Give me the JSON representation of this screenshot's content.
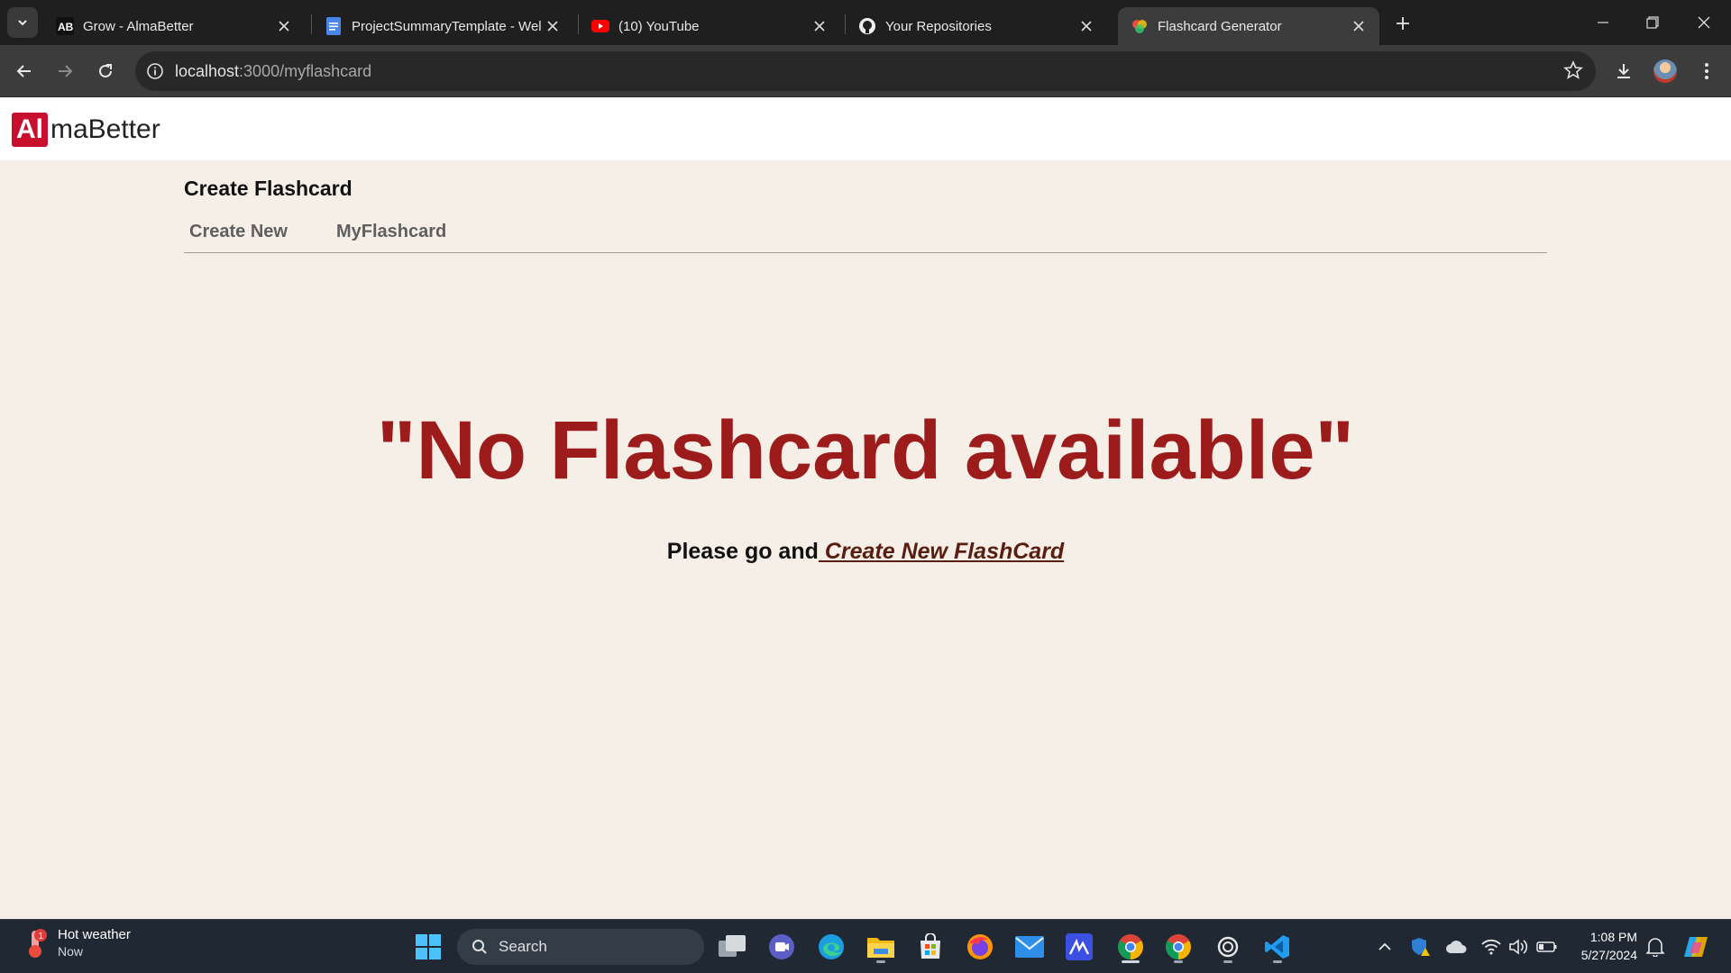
{
  "browser": {
    "tabs": [
      {
        "title": "Grow - AlmaBetter",
        "icon": "almabetter-favicon"
      },
      {
        "title": "ProjectSummaryTemplate - Wel",
        "icon": "google-docs-favicon"
      },
      {
        "title": "(10) YouTube",
        "icon": "youtube-favicon"
      },
      {
        "title": "Your Repositories",
        "icon": "github-favicon"
      },
      {
        "title": "Flashcard Generator",
        "icon": "react-favicon",
        "active": true
      }
    ],
    "url_host": "localhost",
    "url_path": ":3000/myflashcard"
  },
  "app": {
    "logo_mark": "Al",
    "logo_text": "maBetter",
    "page_title": "Create Flashcard",
    "nav": {
      "create_new": "Create New",
      "my_flashcard": "MyFlashcard"
    },
    "empty_state": {
      "title": "\"No Flashcard available\"",
      "prefix": "Please go and",
      "link": " Create New FlashCard"
    }
  },
  "taskbar": {
    "weather_title": "Hot weather",
    "weather_sub": "Now",
    "search_label": "Search",
    "time": "1:08 PM",
    "date": "5/27/2024"
  },
  "colors": {
    "accent_red": "#9c1c1c",
    "logo_red": "#c8102e",
    "page_bg": "#f5efe8"
  }
}
